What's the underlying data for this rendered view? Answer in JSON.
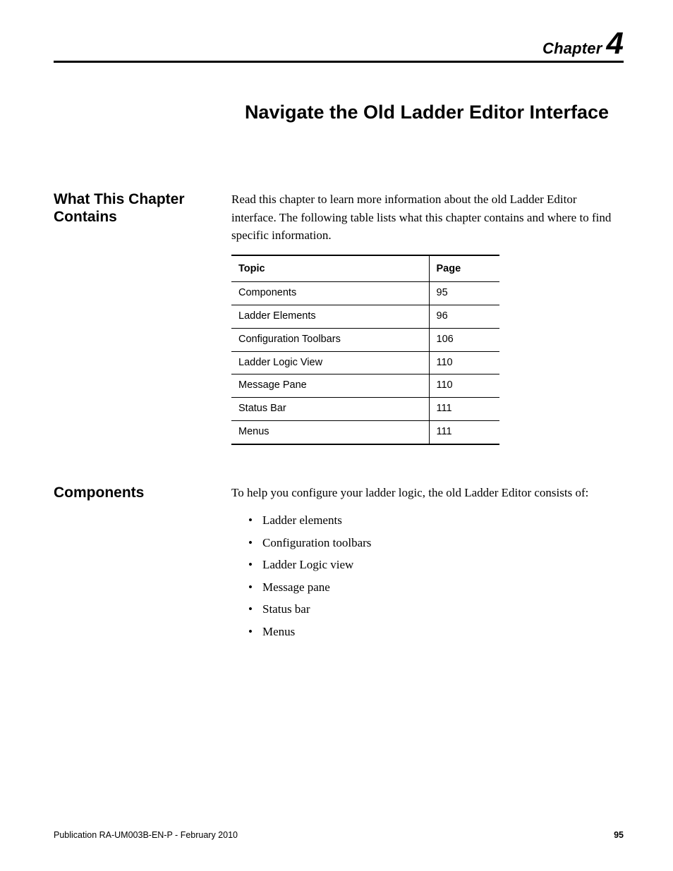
{
  "chapter": {
    "label": "Chapter",
    "number": "4"
  },
  "title": "Navigate the Old Ladder Editor Interface",
  "sections": {
    "what": {
      "heading": "What This Chapter Contains",
      "intro": "Read this chapter to learn more information about the old Ladder Editor interface. The following table lists what this chapter contains and where to find specific information.",
      "table": {
        "headers": {
          "topic": "Topic",
          "page": "Page"
        },
        "rows": [
          {
            "topic": "Components",
            "page": "95"
          },
          {
            "topic": "Ladder Elements",
            "page": "96"
          },
          {
            "topic": "Configuration Toolbars",
            "page": "106"
          },
          {
            "topic": "Ladder Logic View",
            "page": "110"
          },
          {
            "topic": "Message Pane",
            "page": "110"
          },
          {
            "topic": "Status Bar",
            "page": "111"
          },
          {
            "topic": "Menus",
            "page": "111"
          }
        ]
      }
    },
    "components": {
      "heading": "Components",
      "intro": "To help you configure your ladder logic, the old Ladder Editor consists of:",
      "items": [
        "Ladder elements",
        "Configuration toolbars",
        "Ladder Logic view",
        "Message pane",
        "Status bar",
        "Menus"
      ]
    }
  },
  "footer": {
    "publication": "Publication RA-UM003B-EN-P - February 2010",
    "page": "95"
  }
}
